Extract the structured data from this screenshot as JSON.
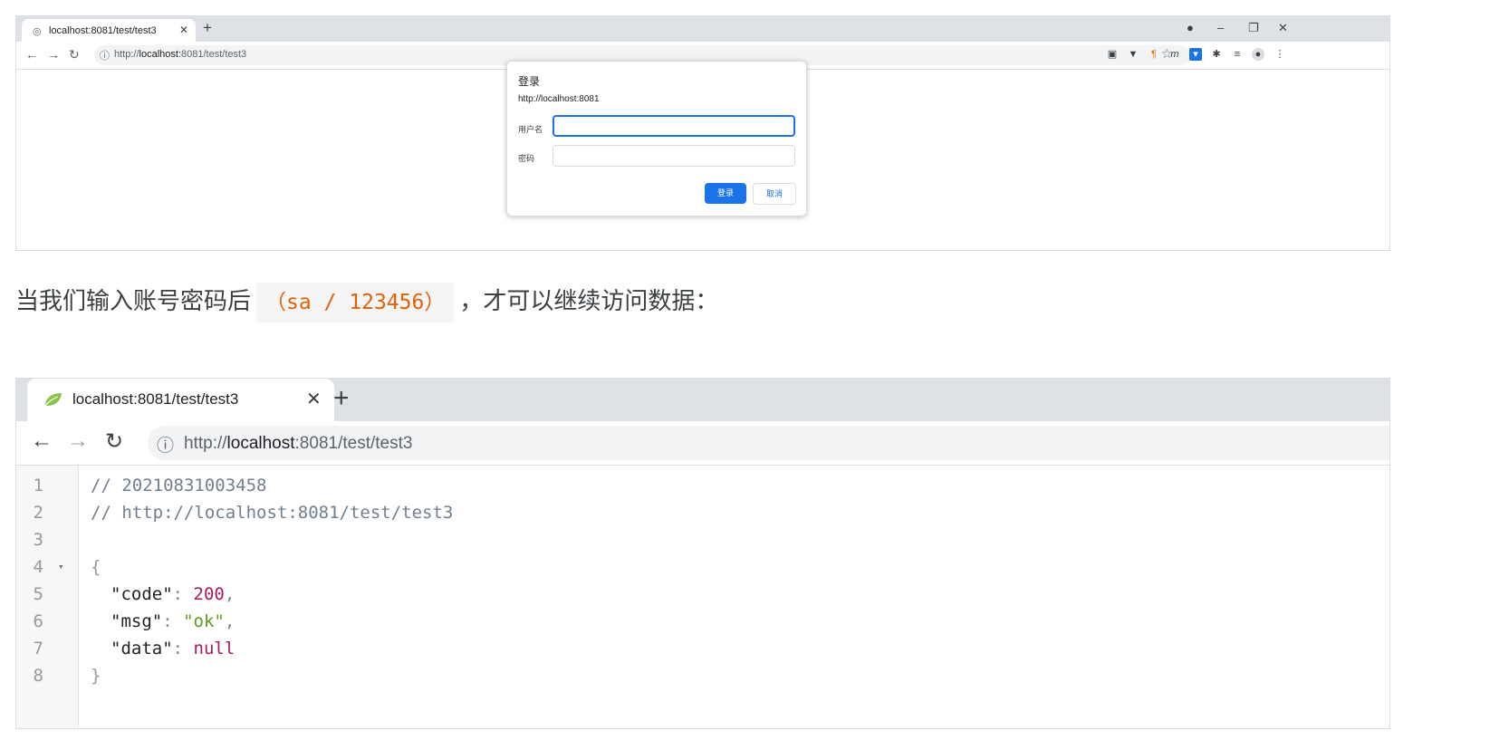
{
  "shot1": {
    "tab_title": "localhost:8081/test/test3",
    "url_scheme": "http://",
    "url_host": "localhost",
    "url_rest": ":8081/test/test3",
    "dialog": {
      "title": "登录",
      "origin": "http://localhost:8081",
      "username_label": "用户名",
      "password_label": "密码",
      "username_value": "",
      "password_value": "",
      "ok_label": "登录",
      "cancel_label": "取消",
      "accent": "#1a73e8"
    },
    "icons": [
      "globe-icon",
      "close-icon",
      "plus-icon",
      "back-icon",
      "forward-icon",
      "reload-icon",
      "info-icon",
      "star-icon",
      "account-icon",
      "menu-icon"
    ]
  },
  "caption": {
    "before": "当我们输入账号密码后",
    "code": "（sa / 123456）",
    "after": "，才可以继续访问数据："
  },
  "shot2": {
    "tab_title": "localhost:8081/test/test3",
    "url_scheme": "http://",
    "url_host": "localhost",
    "url_rest": ":8081/test/test3",
    "code_lines": [
      {
        "n": "1",
        "comment": "// 20210831003458"
      },
      {
        "n": "2",
        "comment": "// http://localhost:8081/test/test3"
      },
      {
        "n": "3"
      },
      {
        "n": "4",
        "brace": "{",
        "fold": "▾"
      },
      {
        "n": "5",
        "key": "\"code\"",
        "sep": ": ",
        "value": "200",
        "trail": ","
      },
      {
        "n": "6",
        "key": "\"msg\"",
        "sep": ": ",
        "value": "\"ok\"",
        "trail": ","
      },
      {
        "n": "7",
        "key": "\"data\"",
        "sep": ": ",
        "value": "null",
        "trail": ""
      },
      {
        "n": "8",
        "brace": "}"
      }
    ]
  }
}
